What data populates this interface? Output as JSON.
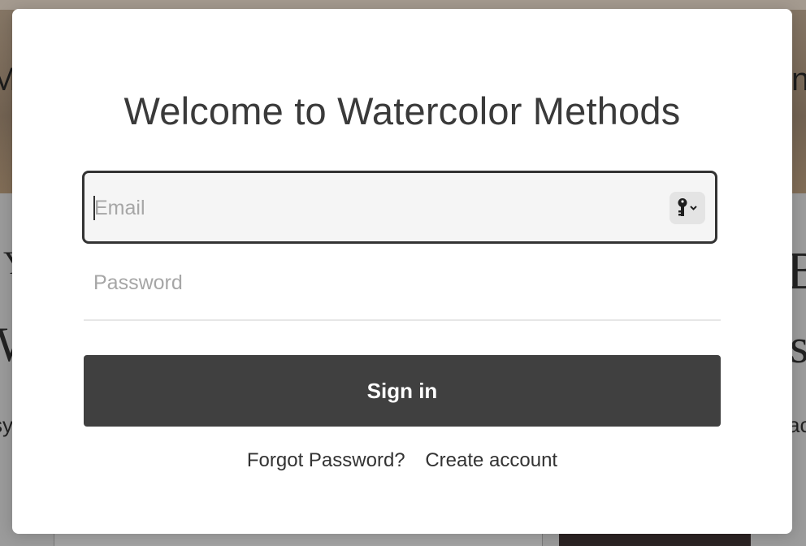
{
  "background": {
    "left_fragments": [
      "Ma",
      "Y",
      "W",
      "sy"
    ],
    "right_fragments": [
      "n",
      "B",
      "s",
      "ac"
    ]
  },
  "modal": {
    "title": "Welcome to Watercolor Methods",
    "email": {
      "placeholder": "Email",
      "value": "",
      "autofill_icon": "key-icon"
    },
    "password": {
      "placeholder": "Password",
      "value": ""
    },
    "sign_in_label": "Sign in",
    "forgot_password_label": "Forgot Password?",
    "create_account_label": "Create account"
  },
  "colors": {
    "primary_button": "#404040",
    "field_border": "#333333",
    "field_background": "#f5f5f5",
    "text": "#3a3a3a"
  }
}
